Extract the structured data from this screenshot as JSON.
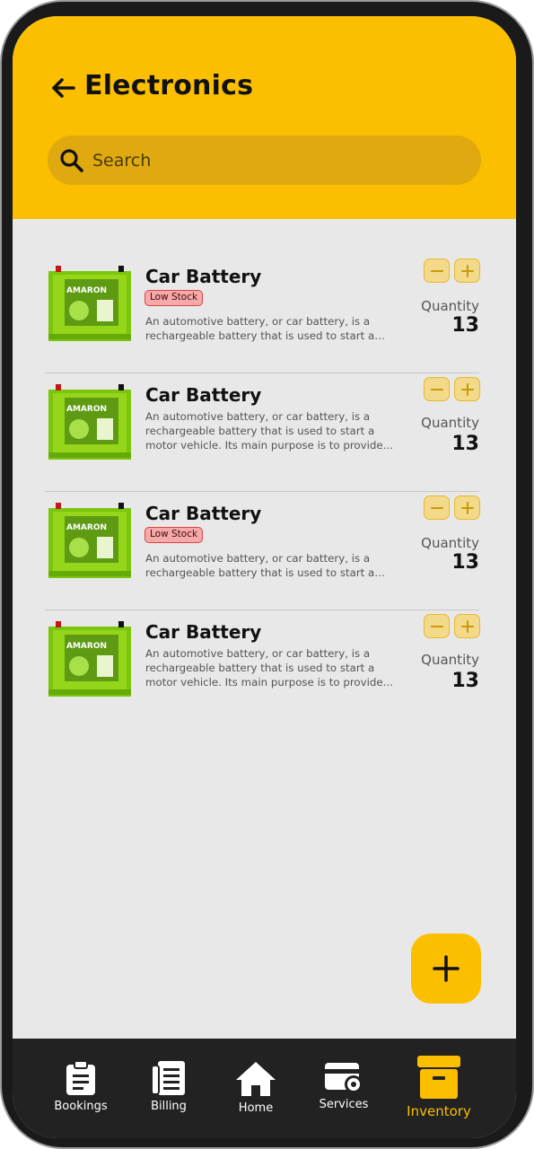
{
  "header": {
    "title": "Electronics",
    "search_placeholder": "Search"
  },
  "items": [
    {
      "title": "Car Battery",
      "badge": "Low Stock",
      "description": "An automotive battery, or car battery, is a rechargeable battery that is used to start a motor vehicle. Its main purpose is to provide...",
      "quantity_label": "Quantity",
      "quantity": "13"
    },
    {
      "title": "Car Battery",
      "badge": "",
      "description": "An automotive battery, or car battery, is a rechargeable battery that is used to start a motor vehicle. Its main purpose is to provide...",
      "quantity_label": "Quantity",
      "quantity": "13"
    },
    {
      "title": "Car Battery",
      "badge": "Low Stock",
      "description": "An automotive battery, or car battery, is a rechargeable battery that is used to start a motor vehicle. Its main purpose is to provide...",
      "quantity_label": "Quantity",
      "quantity": "13"
    },
    {
      "title": "Car Battery",
      "badge": "",
      "description": "An automotive battery, or car battery, is a rechargeable battery that is used to start a motor vehicle. Its main purpose is to provide...",
      "quantity_label": "Quantity",
      "quantity": "13"
    }
  ],
  "product_image": {
    "brand_text": "AMARON"
  },
  "fab": {
    "icon": "plus-icon"
  },
  "nav": {
    "items": [
      {
        "label": "Bookings",
        "icon": "clipboard-icon",
        "active": false
      },
      {
        "label": "Billing",
        "icon": "receipt-icon",
        "active": false
      },
      {
        "label": "Home",
        "icon": "home-icon",
        "active": false
      },
      {
        "label": "Services",
        "icon": "services-card-gear-icon",
        "active": false
      },
      {
        "label": "Inventory",
        "icon": "inventory-box-icon",
        "active": true
      }
    ]
  },
  "colors": {
    "accent": "#fbbf00",
    "search_bg": "#dfa90f",
    "list_bg": "#e8e8e8",
    "nav_bg": "#222222",
    "badge_bg": "#f7a9a9",
    "badge_border": "#d94444"
  }
}
